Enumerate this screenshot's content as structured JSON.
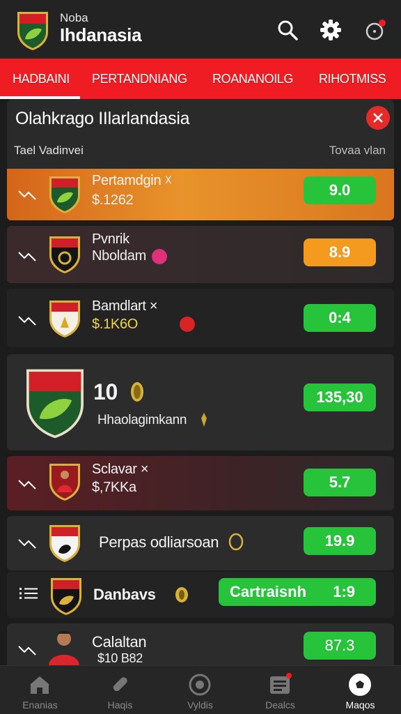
{
  "header": {
    "subtitle": "Noba",
    "title": "Ihdanasia",
    "icons": [
      "search-icon",
      "gear-icon",
      "notification-icon"
    ]
  },
  "tabs": [
    {
      "label": "HADBAINI",
      "active": true
    },
    {
      "label": "PERTANDNIANG",
      "active": false
    },
    {
      "label": "ROANANOILG",
      "active": false
    },
    {
      "label": "RIHOTMISS",
      "active": false
    }
  ],
  "section": {
    "title": "Olahkrago IIlarlandasia",
    "left_column": "Tael Vadinvei",
    "right_column": "Tovaa vlan"
  },
  "rows": [
    {
      "name": "Pertamdgin",
      "mark": "☓",
      "sub": "$.1262",
      "score": "9.0"
    },
    {
      "name": "Pvnrik",
      "sub": "Nboldam",
      "score": "8.9"
    },
    {
      "name": "Bamdlart",
      "mark": "×",
      "sub": "$.1K6O",
      "score": "0:4"
    },
    {
      "name": "10",
      "sub": "Hhaolagimkann",
      "score": "135,30"
    },
    {
      "name": "Sclavar",
      "mark": "×",
      "sub": "$,7KKa",
      "score": "5.7"
    },
    {
      "name": "Perpas odliarsoan",
      "score": "19.9"
    },
    {
      "name": "Danbavs",
      "action": "Cartraisnh",
      "score": "1:9"
    },
    {
      "name": "Calaltan",
      "sub": "$10 B82",
      "score": "87.3"
    }
  ],
  "bottom_nav": [
    {
      "label": "Enanias",
      "icon": "home-icon",
      "active": false
    },
    {
      "label": "Haqis",
      "icon": "whistle-icon",
      "active": false
    },
    {
      "label": "Vyldis",
      "icon": "ball-icon",
      "active": false
    },
    {
      "label": "Dealcs",
      "icon": "news-icon",
      "active": false
    },
    {
      "label": "Maqos",
      "icon": "soccer-ball-icon",
      "active": true
    }
  ],
  "colors": {
    "accent_red": "#ef1d23",
    "score_green": "#27c33a",
    "score_orange": "#f39a1f",
    "background": "#1c1c1d"
  }
}
